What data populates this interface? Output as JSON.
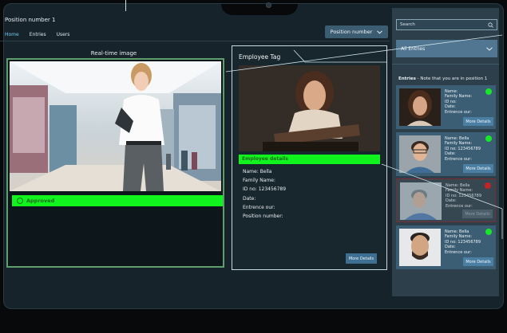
{
  "header": {
    "position_title": "Position number 1",
    "nav": [
      {
        "label": "Home",
        "active": true
      },
      {
        "label": "Entries",
        "active": false
      },
      {
        "label": "Users",
        "active": false
      }
    ],
    "position_dropdown": "Position number"
  },
  "realtime": {
    "title": "Real-time image",
    "status": "Approved"
  },
  "employee_tag": {
    "title": "Employee Tag",
    "details_header": "Employee details",
    "fields": [
      "Name: Bella",
      "Family Name:",
      "ID no: 123456789",
      "Date:",
      "Entrence our:",
      "Position number:"
    ],
    "more_button": "More Details"
  },
  "sidebar": {
    "search_placeholder": "Search",
    "filter_selected": "All Entries",
    "entries_heading_bold": "Entries",
    "entries_heading_note": " - Note that you are in position 1",
    "entries": [
      {
        "lines": [
          "Name:",
          "Family Name:",
          "ID no:",
          "Date:",
          "Entrence our:"
        ],
        "status_color": "#19e52a",
        "more": "More Details"
      },
      {
        "lines": [
          "Name: Bella",
          "Family Name:",
          "ID no: 123456789",
          "Date:",
          "Entrence our:"
        ],
        "status_color": "#19e52a",
        "more": "More Details"
      },
      {
        "lines": [
          "Name: Bella",
          "Family Name:",
          "ID no: 123456789",
          "Date:",
          "Entrence our:"
        ],
        "status_color": "#ea1d1d",
        "more": "More Details"
      },
      {
        "lines": [
          "Name: Bella",
          "Family Name:",
          "ID no: 123456789",
          "Date:",
          "Entrence our:"
        ],
        "status_color": "#19e52a",
        "more": "More Details"
      }
    ]
  },
  "colors": {
    "approved_green": "#11f31d",
    "accent_blue": "#3c5c72",
    "panel_bg": "#16232b"
  }
}
